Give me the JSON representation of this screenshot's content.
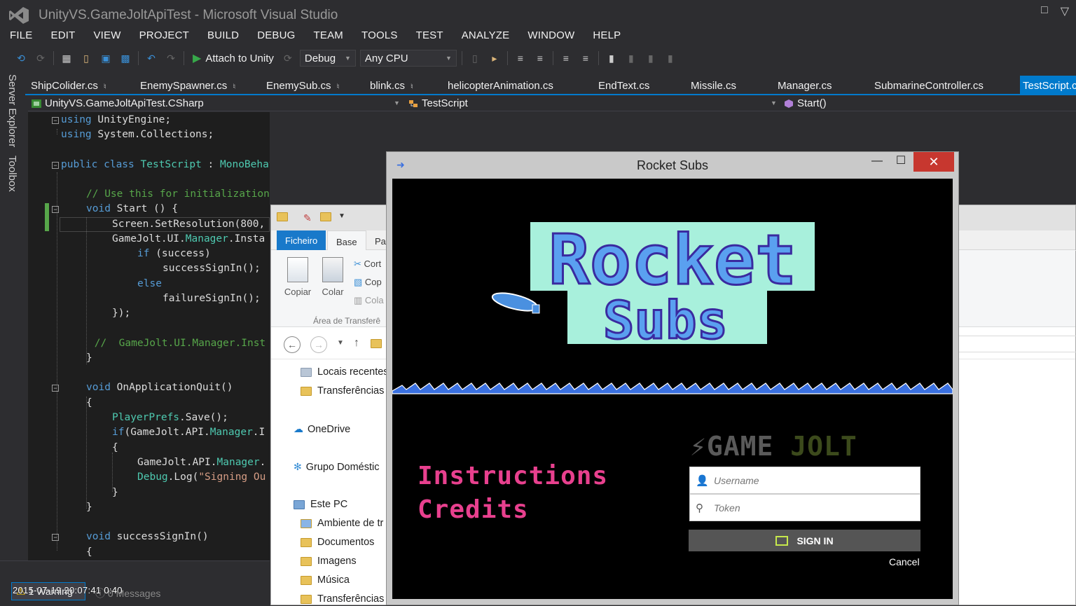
{
  "vs": {
    "title": "UnityVS.GameJoltApiTest - Microsoft Visual Studio",
    "menu": [
      "FILE",
      "EDIT",
      "VIEW",
      "PROJECT",
      "BUILD",
      "DEBUG",
      "TEAM",
      "TOOLS",
      "TEST",
      "ANALYZE",
      "WINDOW",
      "HELP"
    ],
    "toolbar": {
      "attach_label": "Attach to Unity",
      "config": "Debug",
      "platform": "Any CPU"
    },
    "side_tabs": [
      "Server Explorer",
      "Toolbox"
    ],
    "tabs": [
      "ShipColider.cs",
      "EnemySpawner.cs",
      "EnemySub.cs",
      "blink.cs",
      "helicopterAnimation.cs",
      "EndText.cs",
      "Missile.cs",
      "Manager.cs",
      "SubmarineController.cs",
      "TestScript.cs"
    ],
    "active_tab": "TestScript.cs",
    "navbar": {
      "project": "UnityVS.GameJoltApiTest.CSharp",
      "class": "TestScript",
      "member": "Start()"
    },
    "code": {
      "l1_kw": "using",
      "l1_rest": " UnityEngine;",
      "l2_kw": "using",
      "l2_rest": " System.Collections;",
      "l3_kw": "public class",
      "l3_type": "TestScript",
      "l3_colon": " : ",
      "l3_base": "MonoBehaviour",
      "l3_brace": " {",
      "l4": "// Use this for initialization",
      "l5_kw": "void",
      "l5_rest": " Start () {",
      "l6": "Screen.SetResolution(800,",
      "l7_a": "GameJolt.UI.",
      "l7_b": "Manager",
      "l7_c": ".Insta",
      "l8_kw": "if",
      "l8_rest": " (success)",
      "l9": "successSignIn();",
      "l10": "else",
      "l11": "failureSignIn();",
      "l12": "});",
      "l13": " //  GameJolt.UI.Manager.Inst",
      "l14": "}",
      "l15_kw": "void",
      "l15_rest": " OnApplicationQuit()",
      "l16": "{",
      "l17_a": "PlayerPrefs",
      "l17_b": ".Save();",
      "l18_kw": "if",
      "l18_a": "(GameJolt.API.",
      "l18_b": "Manager",
      "l18_c": ".I",
      "l19": "{",
      "l20_a": "GameJolt.API.",
      "l20_b": "Manager",
      "l20_c": ".",
      "l21_a": "Debug",
      "l21_b": ".Log(",
      "l21_c": "\"Signing Ou",
      "l22": "}",
      "l23": "}",
      "l24_kw": "void",
      "l24_rest": " successSignIn()",
      "l25": "{"
    },
    "bottom": {
      "warning_label": "1 Warning",
      "messages_label": "0 Messages",
      "timestamp_overlay": "2015-07-19 20:07:41 0:40"
    }
  },
  "explorer": {
    "ribbon_tabs": [
      "Ficheiro",
      "Base",
      "Par"
    ],
    "ribbon": {
      "copy": "Copiar",
      "paste": "Colar",
      "cut": "Cort",
      "copy_path": "Cop",
      "paste_shortcut": "Cola",
      "group": "Área de Transferê"
    },
    "nav": [
      "Locais recentes",
      "Transferências",
      "OneDrive",
      "Grupo Doméstic",
      "Este PC",
      "Ambiente de tr",
      "Documentos",
      "Imagens",
      "Música",
      "Transferências"
    ]
  },
  "game": {
    "window_title": "Rocket Subs",
    "logo_line1": "Rocket",
    "logo_line2": "Subs",
    "menu": [
      "Instructions",
      "Credits"
    ],
    "gamejolt_a": "GAME",
    "gamejolt_b": "JOLT",
    "username_placeholder": "Username",
    "token_placeholder": "Token",
    "signin_label": "SIGN IN",
    "cancel_label": "Cancel",
    "colors": {
      "pink": "#e8408e",
      "logo_fill": "#5aa0f0",
      "logo_outline": "#a8f0dc",
      "water": "#3a70e0"
    }
  }
}
